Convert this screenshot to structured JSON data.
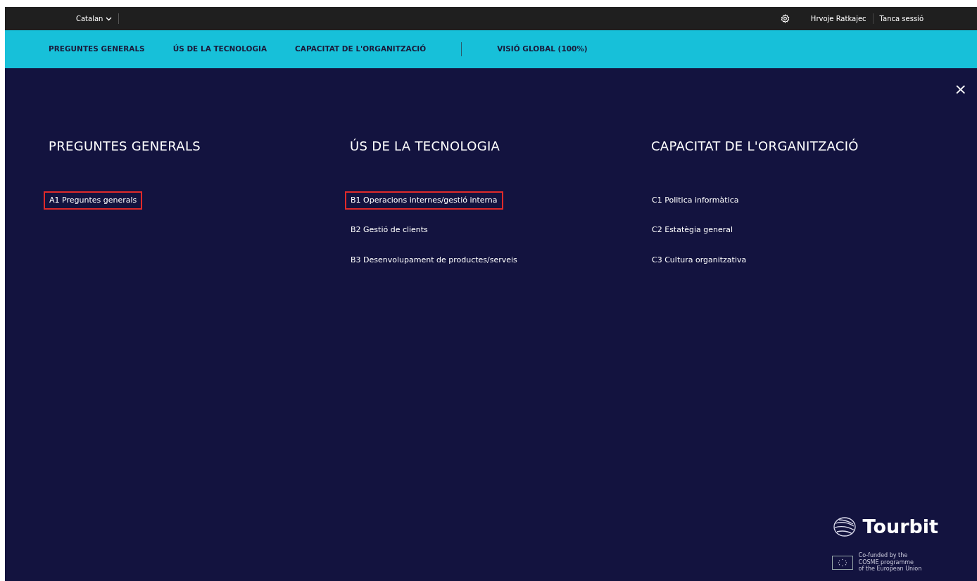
{
  "top_bar": {
    "language": "Catalan",
    "user": "Hrvoje Ratkajec",
    "logout": "Tanca sessió"
  },
  "nav": {
    "items": [
      {
        "label": "PREGUNTES GENERALS",
        "kind": "link"
      },
      {
        "label": "ÚS DE LA TECNOLOGIA",
        "kind": "link"
      },
      {
        "label": "CAPACITAT DE L'ORGANITZACIÓ",
        "kind": "link"
      },
      {
        "label": "VISIÓ GLOBAL (100%)",
        "kind": "summary"
      }
    ]
  },
  "menu": {
    "close": "×",
    "columns": [
      {
        "heading": "PREGUNTES GENERALS",
        "items": [
          {
            "label": "A1 Preguntes generals",
            "highlighted": true
          }
        ]
      },
      {
        "heading": "ÚS DE LA TECNOLOGIA",
        "items": [
          {
            "label": "B1 Operacions internes/gestió interna",
            "highlighted": true
          },
          {
            "label": "B2 Gestió de clients",
            "highlighted": false
          },
          {
            "label": "B3 Desenvolupament de productes/serveis",
            "highlighted": false
          }
        ]
      },
      {
        "heading": "CAPACITAT DE L'ORGANITZACIÓ",
        "items": [
          {
            "label": "C1 Politica informàtica",
            "highlighted": false
          },
          {
            "label": "C2 Estatègia general",
            "highlighted": false
          },
          {
            "label": "C3 Cultura organitzativa",
            "highlighted": false
          }
        ]
      }
    ]
  },
  "footer": {
    "brand": "Tourbit",
    "funding": [
      "Co-funded by the",
      "COSME programme",
      "of the European Union"
    ]
  }
}
